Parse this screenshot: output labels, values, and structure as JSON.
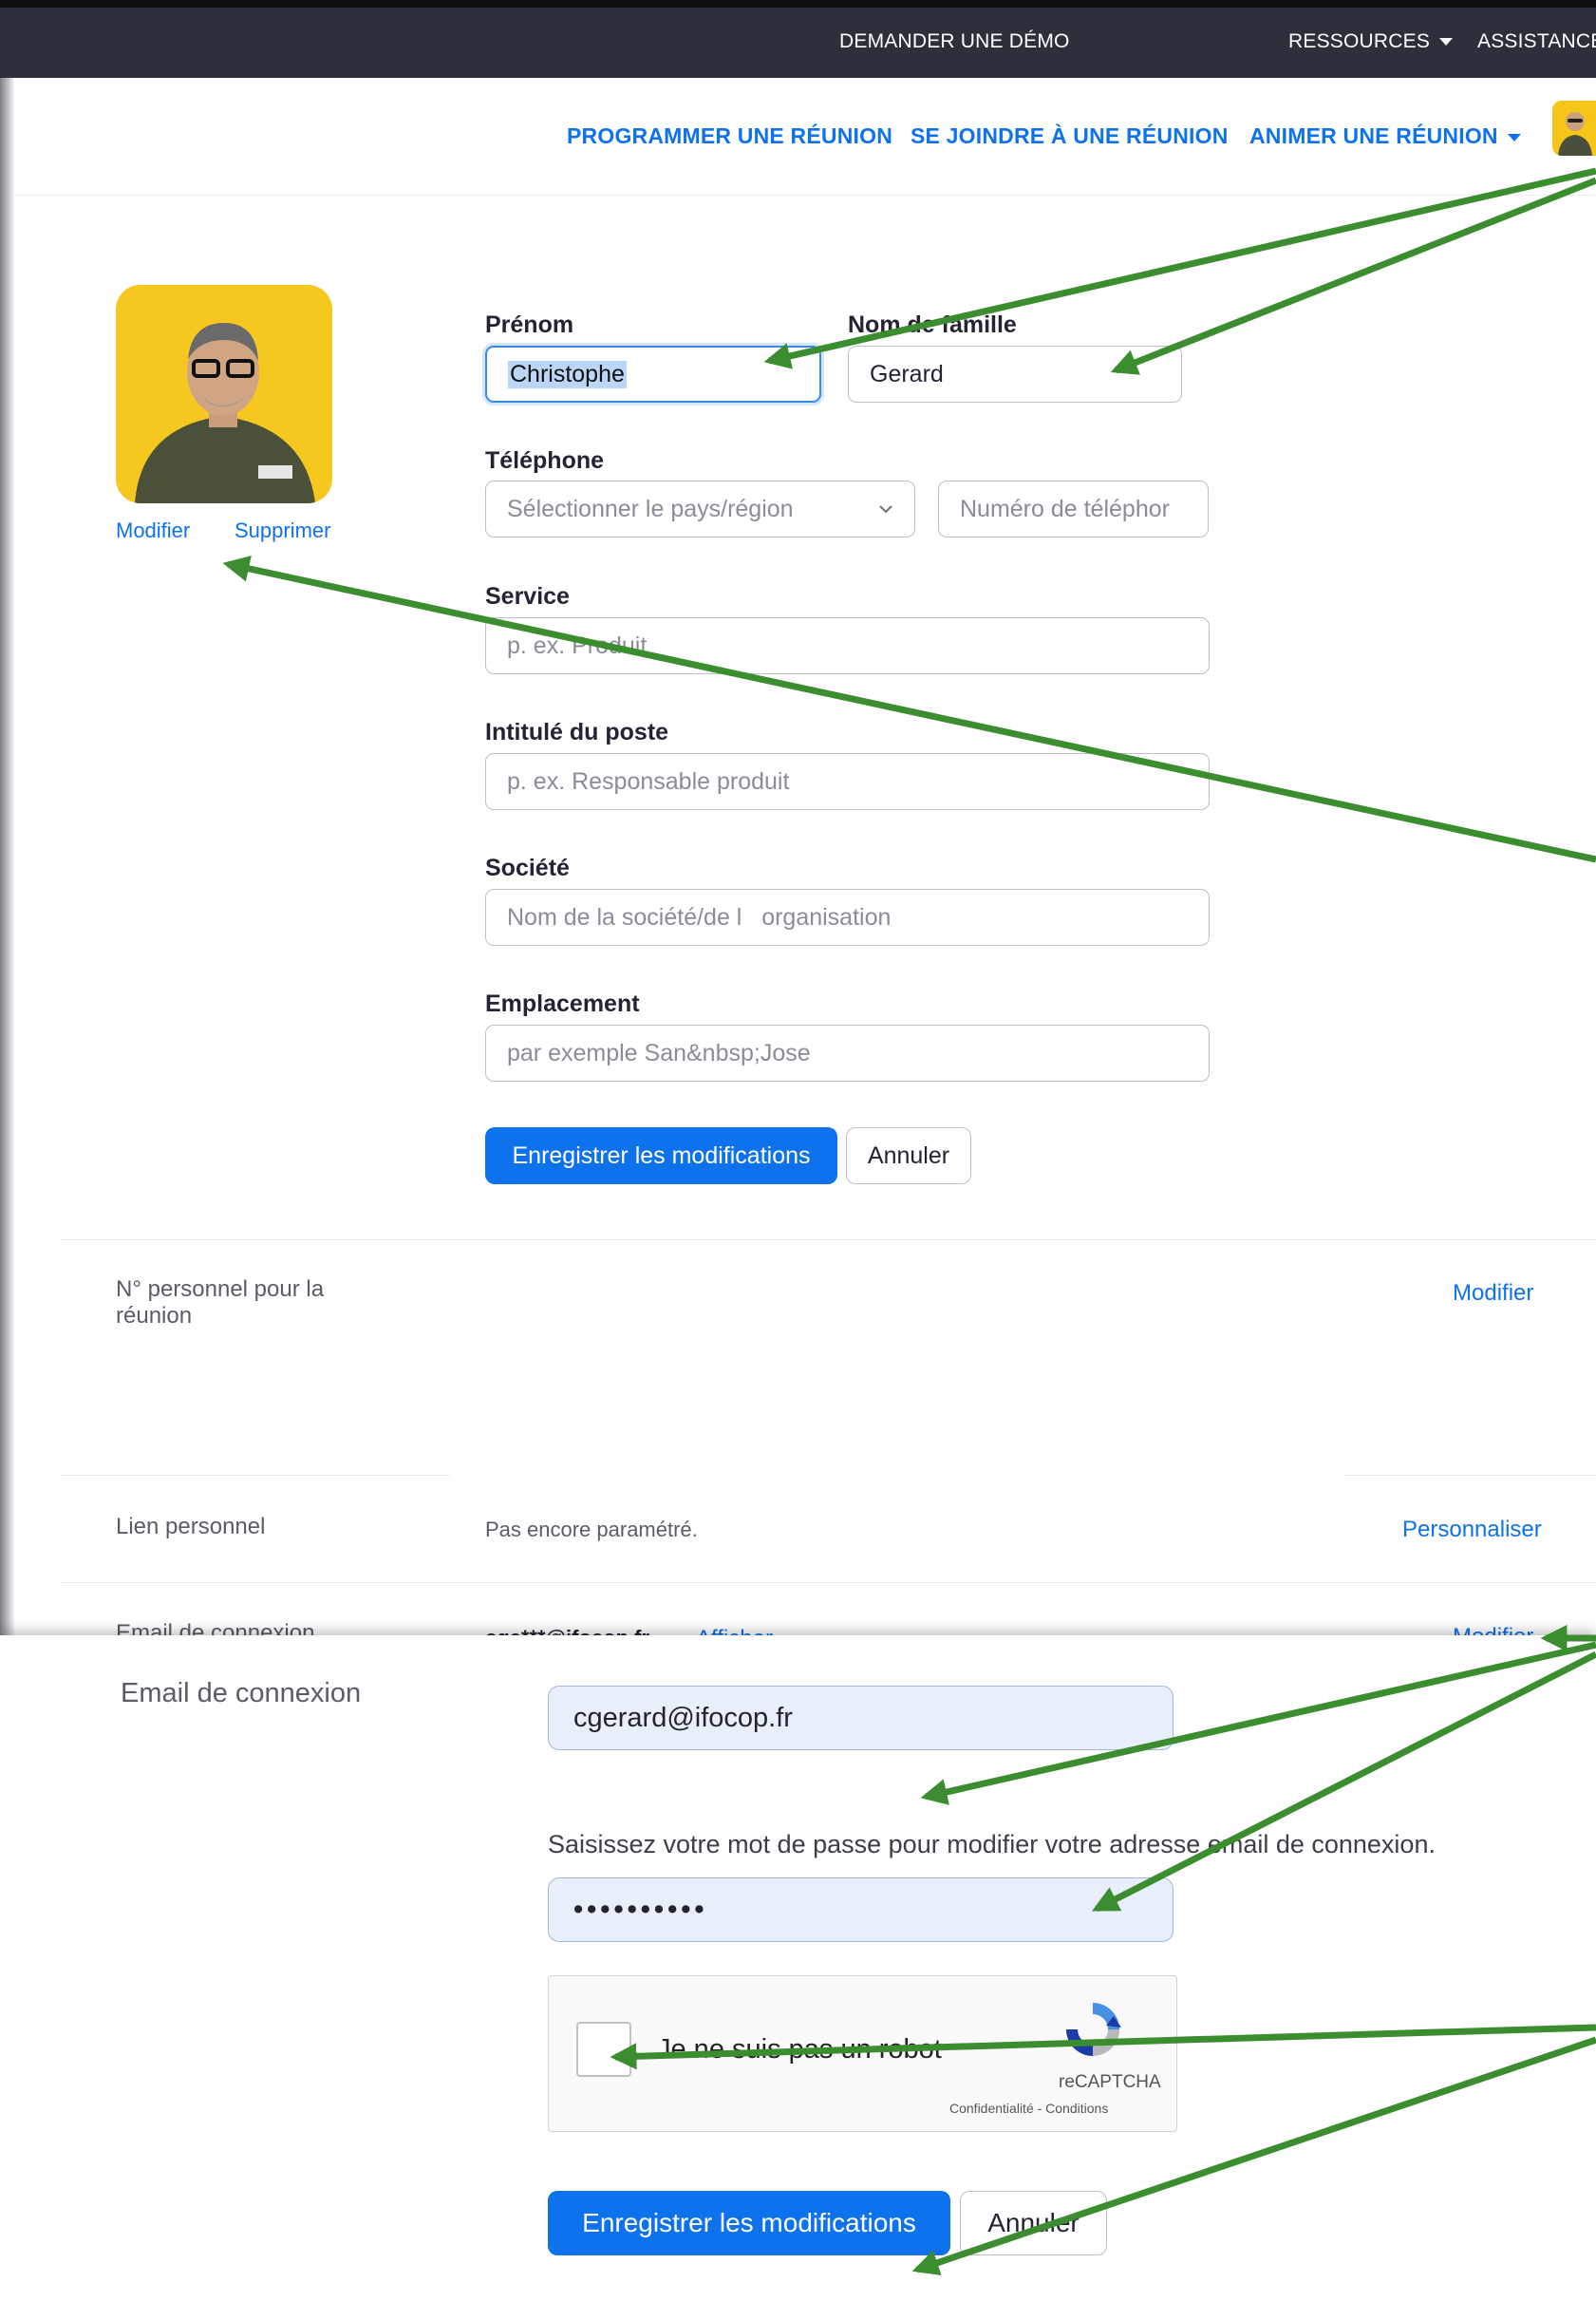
{
  "topbar": {
    "demo": "DEMANDER UNE DÉMO",
    "resources": "RESSOURCES",
    "assistance": "ASSISTANCE"
  },
  "nav": {
    "schedule": "PROGRAMMER UNE RÉUNION",
    "join": "SE JOINDRE À UNE RÉUNION",
    "host": "ANIMER UNE RÉUNION"
  },
  "photo": {
    "edit": "Modifier",
    "delete": "Supprimer"
  },
  "profile_form": {
    "first_name_label": "Prénom",
    "first_name_value": "Christophe",
    "last_name_label": "Nom de famille",
    "last_name_value": "Gerard",
    "phone_label": "Téléphone",
    "country_placeholder": "Sélectionner le pays/région",
    "phone_placeholder": "Numéro de téléphor",
    "service_label": "Service",
    "service_placeholder": "p. ex. Produit",
    "job_label": "Intitulé du poste",
    "job_placeholder": "p. ex. Responsable produit",
    "company_label": "Société",
    "company_placeholder": "Nom de la société/de l   organisation",
    "location_label": "Emplacement",
    "location_placeholder": "par exemple San&nbsp;Jose",
    "save": "Enregistrer les modifications",
    "cancel": "Annuler"
  },
  "personal_meeting": {
    "label": "N° personnel pour la réunion",
    "action": "Modifier"
  },
  "personal_link": {
    "label": "Lien personnel",
    "value": "Pas encore paramétré.",
    "action": "Personnaliser"
  },
  "login_email": {
    "label": "Email de connexion",
    "value": "cge***@ifocop.fr",
    "show": "Afficher",
    "action": "Modifier"
  },
  "email_panel": {
    "label": "Email de connexion",
    "email_value": "cgerard@ifocop.fr",
    "hint": "Saisissez votre mot de passe pour modifier votre adresse email de connexion.",
    "password_value": "••••••••••",
    "captcha_text": "Je ne suis pas un robot",
    "captcha_brand": "reCAPTCHA",
    "captcha_links": "Confidentialité - Conditions",
    "save": "Enregistrer les modifications",
    "cancel": "Annuler"
  },
  "colors": {
    "accent": "#0e72ed",
    "annotation_arrow": "#3b8d2f",
    "topbar": "#2d2f3b"
  }
}
